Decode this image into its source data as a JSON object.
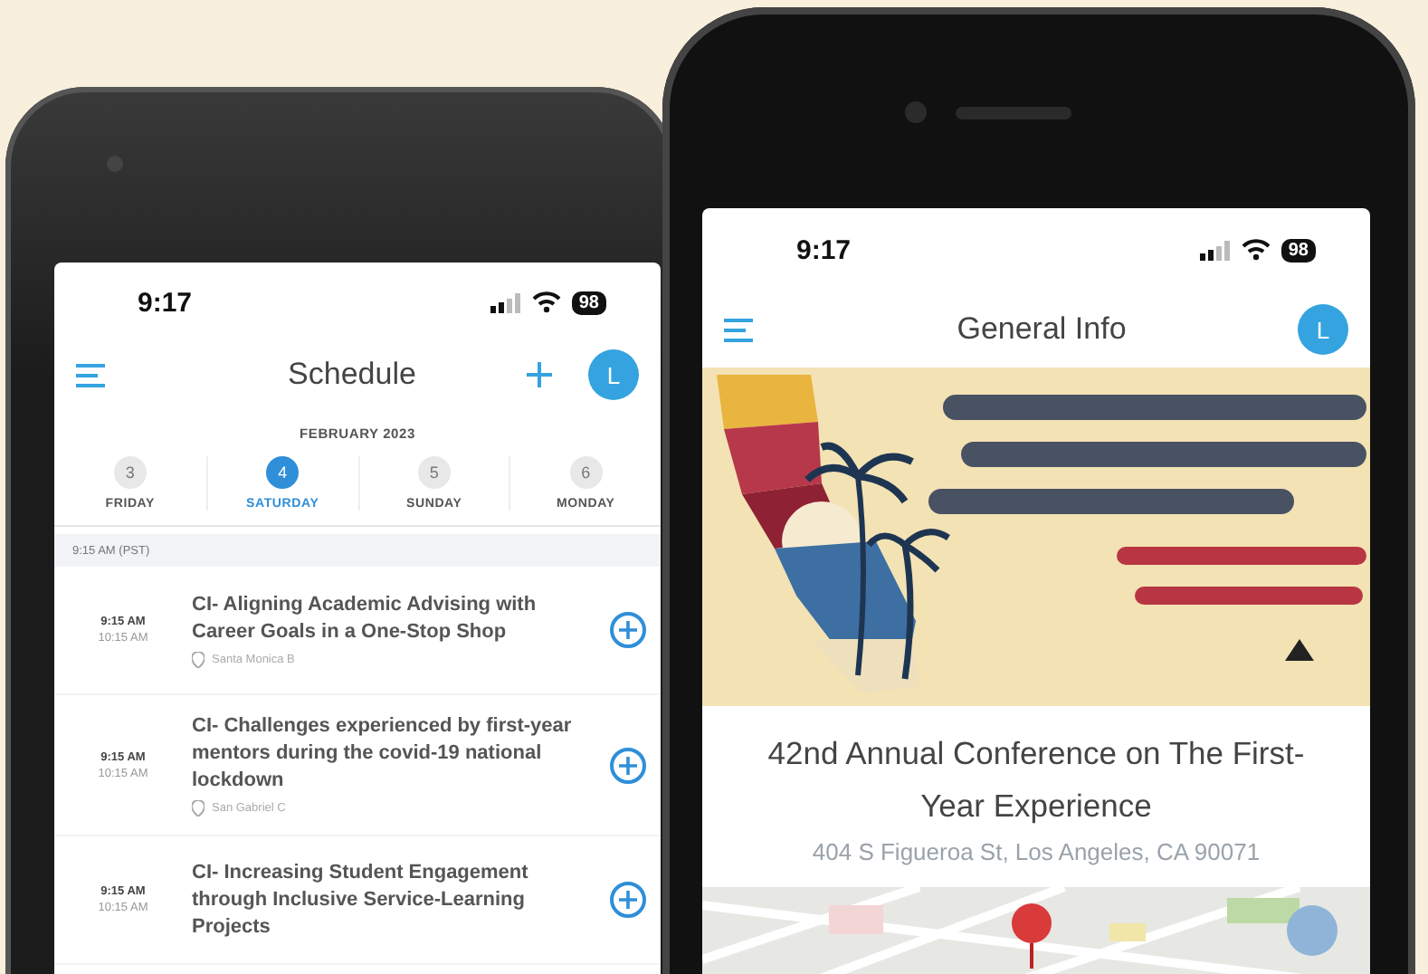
{
  "schedule_phone": {
    "status": {
      "time": "9:17",
      "battery": "98"
    },
    "header": {
      "title": "Schedule",
      "avatar": "L"
    },
    "month": "FEBRUARY 2023",
    "days": [
      {
        "number": "3",
        "weekday": "FRIDAY",
        "selected": false
      },
      {
        "number": "4",
        "weekday": "SATURDAY",
        "selected": true
      },
      {
        "number": "5",
        "weekday": "SUNDAY",
        "selected": false
      },
      {
        "number": "6",
        "weekday": "MONDAY",
        "selected": false
      }
    ],
    "section": "9:15 AM (PST)",
    "sessions": [
      {
        "start": "9:15 AM",
        "end": "10:15 AM",
        "title": "CI- Aligning Academic Advising with Career Goals in a One-Stop Shop",
        "location": "Santa Monica B"
      },
      {
        "start": "9:15 AM",
        "end": "10:15 AM",
        "title": "CI- Challenges experienced by first-year mentors during the covid-19 national lockdown",
        "location": "San Gabriel C"
      },
      {
        "start": "9:15 AM",
        "end": "10:15 AM",
        "title": "CI- Increasing Student Engagement through Inclusive Service-Learning Projects"
      }
    ]
  },
  "info_phone": {
    "status": {
      "time": "9:17",
      "battery": "98"
    },
    "header": {
      "title": "General Info",
      "avatar": "L"
    },
    "event_title": "42nd Annual Conference on The First-Year Experience",
    "address": "404 S Figueroa St, Los Angeles, CA 90071"
  }
}
